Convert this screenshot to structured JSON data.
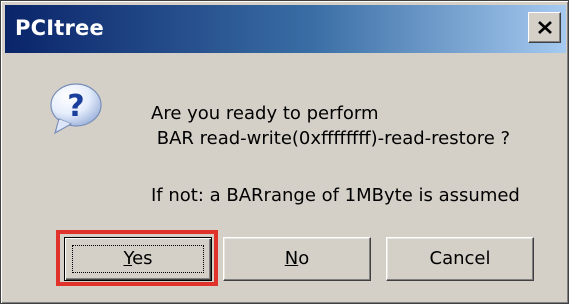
{
  "window": {
    "title": "PCItree"
  },
  "dialog": {
    "icon": "question-icon",
    "message_line1": "Are you ready to perform",
    "message_line2": " BAR read-write(0xffffffff)-read-restore ?",
    "message_line3": "If not: a BARrange of 1MByte is assumed"
  },
  "buttons": {
    "yes": {
      "accel": "Y",
      "rest": "es"
    },
    "no": {
      "accel": "N",
      "rest": "o"
    },
    "cancel": "Cancel"
  },
  "colors": {
    "titlebar_start": "#0a246a",
    "titlebar_end": "#a6caf0",
    "dialog_bg": "#d4d0c8",
    "highlight": "#e0312b"
  }
}
